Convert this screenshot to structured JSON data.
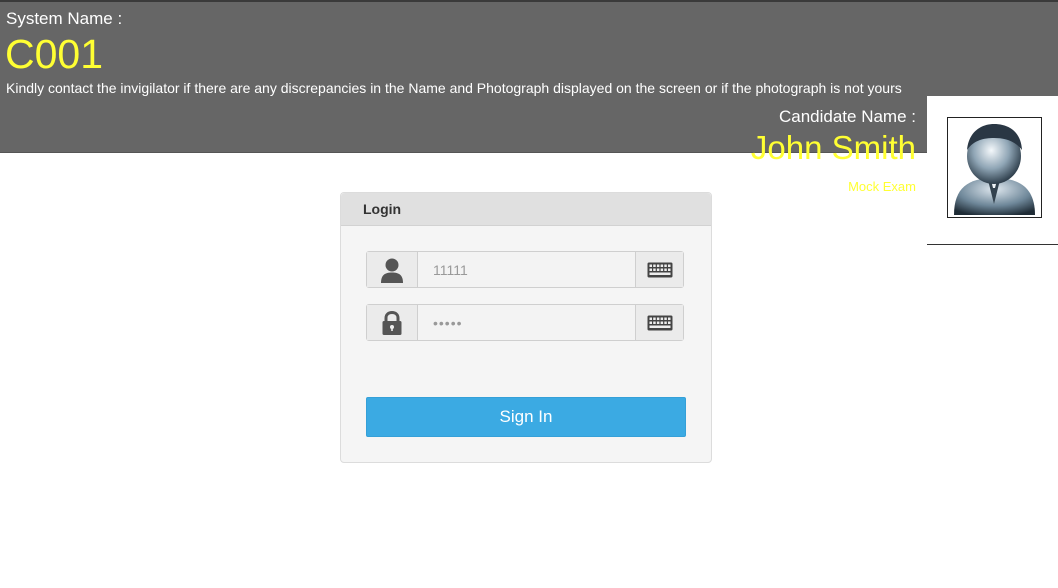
{
  "header": {
    "system_label": "System Name :",
    "system_name": "C001",
    "notice": "Kindly contact the invigilator if there are any discrepancies in the Name and Photograph displayed on the screen or if the photograph is not yours",
    "candidate_label": "Candidate Name :",
    "candidate_name": "John Smith",
    "exam_name": "Mock Exam",
    "photo_icon": "candidate-avatar-icon"
  },
  "login": {
    "title": "Login",
    "username": {
      "value": "11111",
      "icon": "user-icon",
      "keyboard_icon": "keyboard-icon"
    },
    "password": {
      "value": "•••••",
      "icon": "lock-icon",
      "keyboard_icon": "keyboard-icon"
    },
    "sign_in_label": "Sign In"
  },
  "colors": {
    "header_bg": "#666666",
    "highlight_text": "#ffff33",
    "button_bg": "#3baae3"
  }
}
